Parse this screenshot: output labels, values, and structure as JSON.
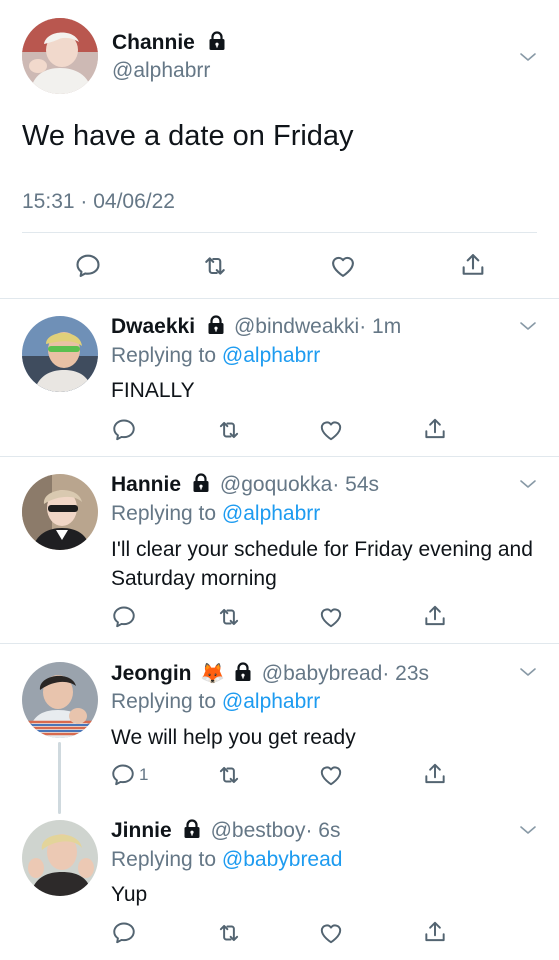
{
  "main_tweet": {
    "display_name": "Channie",
    "handle": "@alphabrr",
    "text": "We have a date on Friday",
    "timestamp": "15:31 · 04/06/22"
  },
  "replies": [
    {
      "display_name": "Dwaekki",
      "handle": "@bindweakki",
      "time": "· 1m",
      "replying_prefix": "Replying to",
      "replying_to": "@alphabrr",
      "text": "FINALLY"
    },
    {
      "display_name": "Hannie",
      "handle": "@goquokka",
      "time": "· 54s",
      "replying_prefix": "Replying to",
      "replying_to": "@alphabrr",
      "text": "I'll clear your schedule for Friday evening and Saturday morning"
    },
    {
      "display_name": "Jeongin",
      "emoji": "🦊",
      "handle": "@babybread",
      "time": "· 23s",
      "replying_prefix": "Replying to",
      "replying_to": "@alphabrr",
      "text": "We will help you get ready",
      "reply_count": "1"
    },
    {
      "display_name": "Jinnie",
      "handle": "@bestboy",
      "time": "· 6s",
      "replying_prefix": "Replying to",
      "replying_to": "@babybread",
      "text": "Yup"
    }
  ],
  "colors": {
    "accent": "#1d9bf0",
    "secondary_text": "#657786",
    "divider": "#e1e8ed"
  }
}
